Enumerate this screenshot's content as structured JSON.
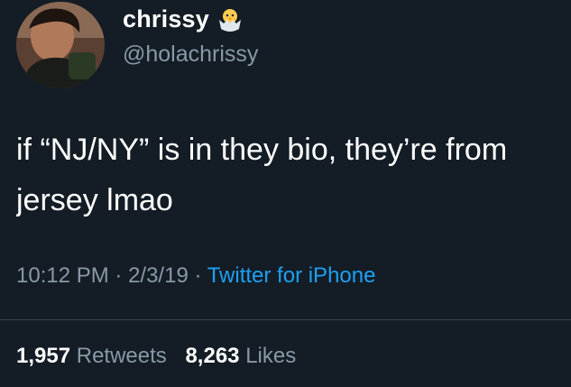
{
  "user": {
    "display_name": "chrissy",
    "name_emoji": "hatching-chick-icon",
    "handle": "@holachrissy"
  },
  "tweet": {
    "line1": "if “NJ/NY” is in they bio, they’re from",
    "line2": "jersey lmao"
  },
  "meta": {
    "time": "10:12 PM",
    "separator1": " · ",
    "date": "2/3/19",
    "separator2": " · ",
    "source": "Twitter for iPhone"
  },
  "stats": {
    "retweets_count": "1,957",
    "retweets_label": "Retweets",
    "likes_count": "8,263",
    "likes_label": "Likes"
  },
  "colors": {
    "background": "#141d26",
    "secondary_text": "#8899a6",
    "link": "#1da1f2",
    "divider": "#38444d"
  }
}
